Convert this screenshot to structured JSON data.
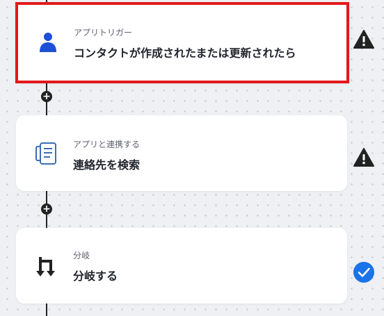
{
  "steps": [
    {
      "subtitle": "アプリトリガー",
      "title": "コンタクトが作成されたまたは更新されたら",
      "icon": "contact-person-icon",
      "status": "warning",
      "selected": true
    },
    {
      "subtitle": "アプリと連携する",
      "title": "連絡先を検索",
      "icon": "address-book-icon",
      "status": "warning",
      "selected": false
    },
    {
      "subtitle": "分岐",
      "title": "分岐する",
      "icon": "branch-icon",
      "status": "complete",
      "selected": false
    }
  ],
  "add_step_symbol": "+",
  "colors": {
    "selected_border": "#e2191c",
    "warning": "#222222",
    "complete": "#1a73e8",
    "contact_icon": "#1e4fd8",
    "address_book_icon": "#3b6db6"
  }
}
